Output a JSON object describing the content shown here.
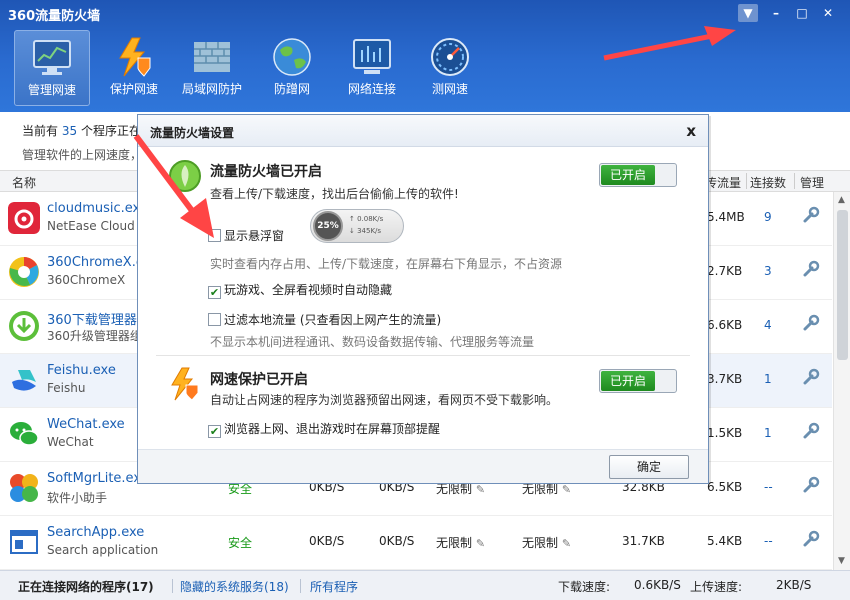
{
  "app": {
    "title": "360流量防火墙"
  },
  "window_controls": {
    "menu": "▼",
    "minimize": "–",
    "maximize": "□",
    "close": "✕"
  },
  "toolbar": [
    {
      "label": "管理网速",
      "icon": "monitor-chart-icon",
      "active": true
    },
    {
      "label": "保护网速",
      "icon": "lightning-shield-icon",
      "active": false
    },
    {
      "label": "局域网防护",
      "icon": "brick-wall-icon",
      "active": false
    },
    {
      "label": "防蹭网",
      "icon": "globe-icon",
      "active": false
    },
    {
      "label": "网络连接",
      "icon": "network-monitor-icon",
      "active": false
    },
    {
      "label": "测网速",
      "icon": "speedometer-icon",
      "active": false
    }
  ],
  "info": {
    "prefix": "当前有",
    "count": "35",
    "suffix": "个程序正在",
    "line2": "管理软件的上网速度，"
  },
  "columns": {
    "name": "名称",
    "total_down": "传流量",
    "connections": "连接数",
    "manage": "管理"
  },
  "rows": [
    {
      "name": "cloudmusic.exe",
      "desc": "NetEase Cloud M",
      "security": "",
      "up": "",
      "down": "",
      "up_limit": "",
      "down_limit": "",
      "total_up": "",
      "total_down": "5.4MB",
      "connections": "9",
      "icon_color": "#e0263a"
    },
    {
      "name": "360ChromeX.exe",
      "desc": "360ChromeX",
      "security": "",
      "up": "",
      "down": "",
      "up_limit": "",
      "down_limit": "",
      "total_up": "",
      "total_down": "2.7KB",
      "connections": "3",
      "icon_color": "#f2a51a"
    },
    {
      "name": "360下载管理器",
      "desc": "360升级管理器组",
      "security": "",
      "up": "",
      "down": "",
      "up_limit": "",
      "down_limit": "",
      "total_up": "",
      "total_down": "6.6KB",
      "connections": "4",
      "icon_color": "#3fae3f"
    },
    {
      "name": "Feishu.exe",
      "desc": "Feishu",
      "security": "",
      "up": "",
      "down": "",
      "up_limit": "",
      "down_limit": "",
      "total_up": "",
      "total_down": "3.7KB",
      "connections": "1",
      "icon_color": "#2e6fe0"
    },
    {
      "name": "WeChat.exe",
      "desc": "WeChat",
      "security": "",
      "up": "",
      "down": "",
      "up_limit": "",
      "down_limit": "",
      "total_up": "",
      "total_down": "1.5KB",
      "connections": "1",
      "icon_color": "#2aae3a"
    },
    {
      "name": "SoftMgrLite.exe",
      "desc": "软件小助手",
      "security": "安全",
      "up": "0KB/S",
      "down": "0KB/S",
      "up_limit": "无限制",
      "down_limit": "无限制",
      "total_up": "32.8KB",
      "total_down": "6.5KB",
      "connections": "--",
      "icon_color": "#e84a2a"
    },
    {
      "name": "SearchApp.exe",
      "desc": "Search application",
      "security": "安全",
      "up": "0KB/S",
      "down": "0KB/S",
      "up_limit": "无限制",
      "down_limit": "无限制",
      "total_up": "31.7KB",
      "total_down": "5.4KB",
      "connections": "--",
      "icon_color": "#2b6cc4"
    }
  ],
  "status": {
    "tab_connecting": "正在连接网络的程序(17)",
    "tab_hidden": "隐藏的系统服务(18)",
    "tab_all": "所有程序",
    "down_label": "下载速度:",
    "down_value": "0.6KB/S",
    "up_label": "上传速度:",
    "up_value": "2KB/S"
  },
  "dialog": {
    "title": "流量防火墙设置",
    "close": "x",
    "firewall": {
      "title": "流量防火墙已开启",
      "subtitle": "查看上传/下载速度，找出后台偷偷上传的软件!",
      "toggle": "已开启"
    },
    "float_widget": {
      "checkbox_label": "显示悬浮窗",
      "checked": false,
      "percent": "25%",
      "up_rate": "↑ 0.08K/s",
      "down_rate": "↓ 345K/s",
      "note": "实时查看内存占用、上传/下载速度，在屏幕右下角显示，不占资源"
    },
    "game_hide": {
      "label": "玩游戏、全屏看视频时自动隐藏",
      "checked": true
    },
    "filter_local": {
      "label": "过滤本地流量 (只查看因上网产生的流量)",
      "checked": false,
      "note": "不显示本机间进程通讯、数码设备数据传输、代理服务等流量"
    },
    "speed_protect": {
      "title": "网速保护已开启",
      "subtitle": "自动让占网速的程序为浏览器预留出网速，看网页不受下载影响。",
      "toggle": "已开启"
    },
    "browser_notify": {
      "label": "浏览器上网、退出游戏时在屏幕顶部提醒",
      "checked": true
    },
    "ok": "确定"
  },
  "colors": {
    "accent": "#1a5fb4",
    "titlebar": "#2a6bd0",
    "toggle_on": "#2a9d2a",
    "arrow": "#ff3b3b"
  }
}
